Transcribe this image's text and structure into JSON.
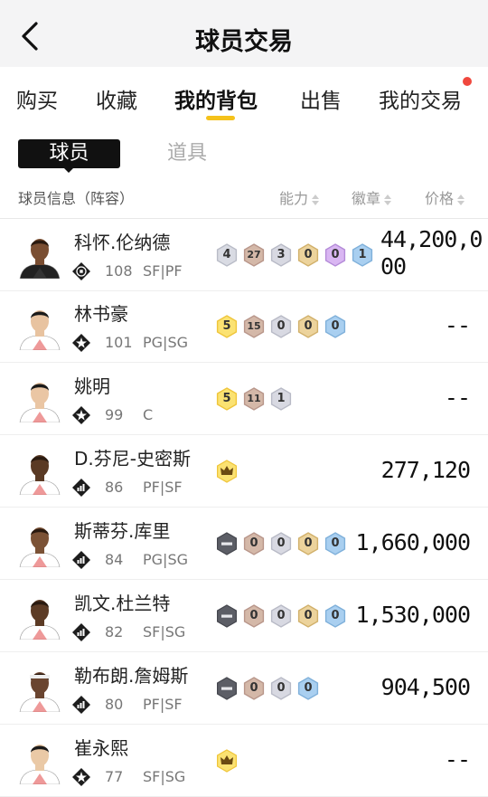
{
  "header": {
    "title": "球员交易"
  },
  "tabs": [
    {
      "label": "购买"
    },
    {
      "label": "收藏"
    },
    {
      "label": "我的背包"
    },
    {
      "label": "出售"
    },
    {
      "label": "我的交易"
    }
  ],
  "subtabs": {
    "active": "球员",
    "inactive": "道具"
  },
  "columns": {
    "info": "球员信息（阵容）",
    "ability": "能力",
    "badge": "徽章",
    "price": "价格"
  },
  "colors": {
    "accent": "#f5c21b",
    "notify": "#f0483e"
  },
  "players": [
    {
      "name": "科怀.伦纳德",
      "rating": "108",
      "pos": "SF|PF",
      "team_icon": "nets-badge-icon",
      "badges": [
        [
          "grey",
          "4"
        ],
        [
          "bronze",
          "27"
        ],
        [
          "silver",
          "3"
        ],
        [
          "gold",
          "0"
        ],
        [
          "purple",
          "0"
        ],
        [
          "blue",
          "1"
        ]
      ],
      "price_l1": "44,200,0",
      "price_l2": "00"
    },
    {
      "name": "林书豪",
      "rating": "101",
      "pos": "PG|SG",
      "team_icon": "star-badge-icon",
      "badges": [
        [
          "yellow",
          "5"
        ],
        [
          "bronze",
          "15"
        ],
        [
          "silver",
          "0"
        ],
        [
          "gold",
          "0"
        ],
        [
          "blue",
          "0"
        ]
      ],
      "price_l1": "--",
      "price_l2": ""
    },
    {
      "name": "姚明",
      "rating": "99",
      "pos": "C",
      "team_icon": "star-badge-icon",
      "badges": [
        [
          "yellow",
          "5"
        ],
        [
          "bronze",
          "11"
        ],
        [
          "silver",
          "1"
        ]
      ],
      "price_l1": "--",
      "price_l2": ""
    },
    {
      "name": "D.芬尼-史密斯",
      "rating": "86",
      "pos": "PF|SF",
      "team_icon": "bars-badge-icon",
      "badges": [
        [
          "crown",
          ""
        ]
      ],
      "price_l1": "277,120",
      "price_l2": ""
    },
    {
      "name": "斯蒂芬.库里",
      "rating": "84",
      "pos": "PG|SG",
      "team_icon": "bars-badge-icon",
      "badges": [
        [
          "minus",
          ""
        ],
        [
          "bronze",
          "0"
        ],
        [
          "silver",
          "0"
        ],
        [
          "gold",
          "0"
        ],
        [
          "blue",
          "0"
        ]
      ],
      "price_l1": "1,660,000",
      "price_l2": ""
    },
    {
      "name": "凯文.杜兰特",
      "rating": "82",
      "pos": "SF|SG",
      "team_icon": "bars-badge-icon",
      "badges": [
        [
          "minus",
          ""
        ],
        [
          "bronze",
          "0"
        ],
        [
          "silver",
          "0"
        ],
        [
          "gold",
          "0"
        ],
        [
          "blue",
          "0"
        ]
      ],
      "price_l1": "1,530,000",
      "price_l2": ""
    },
    {
      "name": "勒布朗.詹姆斯",
      "rating": "80",
      "pos": "PF|SF",
      "team_icon": "bars-badge-icon",
      "badges": [
        [
          "minus",
          ""
        ],
        [
          "bronze",
          "0"
        ],
        [
          "silver",
          "0"
        ],
        [
          "blue",
          "0"
        ]
      ],
      "price_l1": "904,500",
      "price_l2": ""
    },
    {
      "name": "崔永熙",
      "rating": "77",
      "pos": "SF|SG",
      "team_icon": "star-badge-icon",
      "badges": [
        [
          "crown",
          ""
        ]
      ],
      "price_l1": "--",
      "price_l2": ""
    }
  ]
}
